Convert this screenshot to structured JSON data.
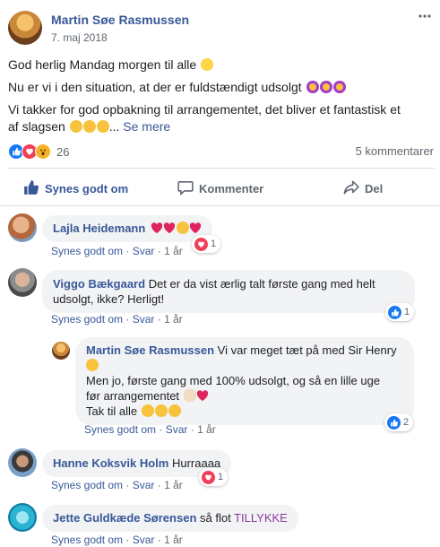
{
  "post": {
    "author": "Martin Søe Rasmussen",
    "date": "7. maj 2018",
    "line1": "God herlig Mandag morgen til alle",
    "line2": "Nu er vi i den situation, at der er fuldstændigt udsolgt",
    "line3a": "Vi takker for god opbakning til arrangementet, det bliver et fantastisk et",
    "line3b": "af slagsen",
    "ellipsis": "...",
    "see_more": "Se mere",
    "reaction_count": "26",
    "comment_count": "5 kommentarer",
    "more_icon": "three-dots-icon"
  },
  "actions": {
    "like": "Synes godt om",
    "comment": "Kommenter",
    "share": "Del"
  },
  "comments": [
    {
      "author": "Lajla Heidemann",
      "text": "",
      "like": "Synes godt om",
      "reply": "Svar",
      "time": "1 år",
      "reaction_count": "1",
      "reaction_icon": "love-icon"
    },
    {
      "author": "Viggo Bækgaard",
      "text_line1": "Det er da vist ærlig talt første gang med helt",
      "text_line2": "udsolgt, ikke? Herligt!",
      "like": "Synes godt om",
      "reply": "Svar",
      "time": "1 år",
      "reaction_count": "1",
      "reaction_icon": "like-icon"
    },
    {
      "author": "Martin Søe Rasmussen",
      "text_line1": "Vi var meget tæt på med Sir Henry",
      "text_line2": "Men jo, første gang med 100% udsolgt, og så en lille uge",
      "text_line3": "før arrangementet",
      "text_line4": "Tak til alle",
      "like": "Synes godt om",
      "reply": "Svar",
      "time": "1 år",
      "reaction_count": "2",
      "reaction_icon": "like-icon"
    },
    {
      "author": "Hanne Koksvik Holm",
      "text": "Hurraaaa",
      "like": "Synes godt om",
      "reply": "Svar",
      "time": "1 år",
      "reaction_count": "1",
      "reaction_icon": "love-icon"
    },
    {
      "author": "Jette Guldkæde Sørensen",
      "text": "så flot",
      "tag": "TILLYKKE",
      "like": "Synes godt om",
      "reply": "Svar",
      "time": "1 år"
    }
  ],
  "separator": "·",
  "colors": {
    "link": "#385898",
    "like_blue": "#1877f2",
    "love_red": "#f33e58",
    "wow_yellow": "#f7b125",
    "tag_purple": "#8b3a9c"
  }
}
